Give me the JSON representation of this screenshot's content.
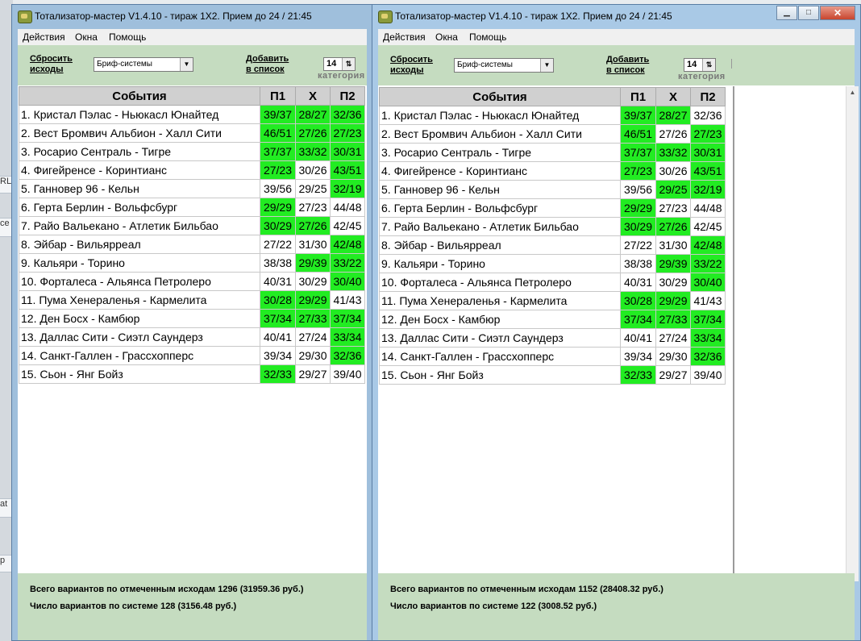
{
  "background": {
    "fragments": [
      "RL",
      "ce",
      "at",
      "p"
    ]
  },
  "colors": {
    "highlight": "#22ec22",
    "panel": "#c5dcc0"
  },
  "windows": [
    {
      "title": "Тотализатор-мастер V1.4.10 - тираж 1Х2. Прием до 24 / 21:45",
      "menu": [
        "Действия",
        "Окна",
        "Помощь"
      ],
      "toolbar": {
        "reset_line1": "Сбросить",
        "reset_line2": "исходы",
        "system": "Бриф-системы",
        "add_line1": "Добавить",
        "add_line2": "в список",
        "category_value": "14",
        "category_label": "категория"
      },
      "headers": [
        "События",
        "П1",
        "Х",
        "П2"
      ],
      "events": [
        {
          "name": "1. Кристал Пэлас - Ньюкасл Юнайтед",
          "odds": [
            "39/37",
            "28/27",
            "32/36"
          ],
          "on": [
            true,
            true,
            true
          ]
        },
        {
          "name": "2. Вест Бромвич Альбион - Халл Сити",
          "odds": [
            "46/51",
            "27/26",
            "27/23"
          ],
          "on": [
            true,
            true,
            true
          ]
        },
        {
          "name": "3. Росарио Сентраль - Тигре",
          "odds": [
            "37/37",
            "33/32",
            "30/31"
          ],
          "on": [
            true,
            true,
            true
          ]
        },
        {
          "name": "4. Фигейренсе - Коринтианс",
          "odds": [
            "27/23",
            "30/26",
            "43/51"
          ],
          "on": [
            true,
            false,
            true
          ]
        },
        {
          "name": "5. Ганновер 96 - Кельн",
          "odds": [
            "39/56",
            "29/25",
            "32/19"
          ],
          "on": [
            false,
            false,
            true
          ]
        },
        {
          "name": "6. Герта Берлин - Вольфсбург",
          "odds": [
            "29/29",
            "27/23",
            "44/48"
          ],
          "on": [
            true,
            false,
            false
          ]
        },
        {
          "name": "7. Райо Вальекано - Атлетик Бильбао",
          "odds": [
            "30/29",
            "27/26",
            "42/45"
          ],
          "on": [
            true,
            true,
            false
          ]
        },
        {
          "name": "8. Эйбар - Вильярреал",
          "odds": [
            "27/22",
            "31/30",
            "42/48"
          ],
          "on": [
            false,
            false,
            true
          ]
        },
        {
          "name": "9. Кальяри - Торино",
          "odds": [
            "38/38",
            "29/39",
            "33/22"
          ],
          "on": [
            false,
            true,
            true
          ]
        },
        {
          "name": "10. Форталеса - Альянса Петролеро",
          "odds": [
            "40/31",
            "30/29",
            "30/40"
          ],
          "on": [
            false,
            false,
            true
          ]
        },
        {
          "name": "11. Пума Хенераленья - Кармелита",
          "odds": [
            "30/28",
            "29/29",
            "41/43"
          ],
          "on": [
            true,
            true,
            false
          ]
        },
        {
          "name": "12. Ден Босх - Камбюр",
          "odds": [
            "37/34",
            "27/33",
            "37/34"
          ],
          "on": [
            true,
            true,
            true
          ]
        },
        {
          "name": "13. Даллас Сити - Сиэтл Саундерз",
          "odds": [
            "40/41",
            "27/24",
            "33/34"
          ],
          "on": [
            false,
            false,
            true
          ]
        },
        {
          "name": "14. Санкт-Галлен - Грассхопперс",
          "odds": [
            "39/34",
            "29/30",
            "32/36"
          ],
          "on": [
            false,
            false,
            true
          ]
        },
        {
          "name": "15. Сьон - Янг Бойз",
          "odds": [
            "32/33",
            "29/27",
            "39/40"
          ],
          "on": [
            true,
            false,
            false
          ]
        }
      ],
      "status": {
        "line1": "Всего вариантов по отмеченным исходам 1296 (31959.36 руб.)",
        "line2": "Число вариантов по системе 128 (3156.48 руб.)"
      }
    },
    {
      "title": "Тотализатор-мастер V1.4.10 - тираж 1Х2. Прием до 24 / 21:45",
      "menu": [
        "Действия",
        "Окна",
        "Помощь"
      ],
      "toolbar": {
        "reset_line1": "Сбросить",
        "reset_line2": "исходы",
        "system": "Бриф-системы",
        "add_line1": "Добавить",
        "add_line2": "в список",
        "category_value": "14",
        "category_label": "категория"
      },
      "headers": [
        "События",
        "П1",
        "Х",
        "П2"
      ],
      "events": [
        {
          "name": "1. Кристал Пэлас - Ньюкасл Юнайтед",
          "odds": [
            "39/37",
            "28/27",
            "32/36"
          ],
          "on": [
            true,
            true,
            false
          ]
        },
        {
          "name": "2. Вест Бромвич Альбион - Халл Сити",
          "odds": [
            "46/51",
            "27/26",
            "27/23"
          ],
          "on": [
            true,
            false,
            true
          ]
        },
        {
          "name": "3. Росарио Сентраль - Тигре",
          "odds": [
            "37/37",
            "33/32",
            "30/31"
          ],
          "on": [
            true,
            true,
            true
          ]
        },
        {
          "name": "4. Фигейренсе - Коринтианс",
          "odds": [
            "27/23",
            "30/26",
            "43/51"
          ],
          "on": [
            true,
            false,
            true
          ]
        },
        {
          "name": "5. Ганновер 96 - Кельн",
          "odds": [
            "39/56",
            "29/25",
            "32/19"
          ],
          "on": [
            false,
            true,
            true
          ]
        },
        {
          "name": "6. Герта Берлин - Вольфсбург",
          "odds": [
            "29/29",
            "27/23",
            "44/48"
          ],
          "on": [
            true,
            false,
            false
          ]
        },
        {
          "name": "7. Райо Вальекано - Атлетик Бильбао",
          "odds": [
            "30/29",
            "27/26",
            "42/45"
          ],
          "on": [
            true,
            true,
            false
          ]
        },
        {
          "name": "8. Эйбар - Вильярреал",
          "odds": [
            "27/22",
            "31/30",
            "42/48"
          ],
          "on": [
            false,
            false,
            true
          ]
        },
        {
          "name": "9. Кальяри - Торино",
          "odds": [
            "38/38",
            "29/39",
            "33/22"
          ],
          "on": [
            false,
            true,
            true
          ]
        },
        {
          "name": "10. Форталеса - Альянса Петролеро",
          "odds": [
            "40/31",
            "30/29",
            "30/40"
          ],
          "on": [
            false,
            false,
            true
          ]
        },
        {
          "name": "11. Пума Хенераленья - Кармелита",
          "odds": [
            "30/28",
            "29/29",
            "41/43"
          ],
          "on": [
            true,
            true,
            false
          ]
        },
        {
          "name": "12. Ден Босх - Камбюр",
          "odds": [
            "37/34",
            "27/33",
            "37/34"
          ],
          "on": [
            true,
            true,
            true
          ]
        },
        {
          "name": "13. Даллас Сити - Сиэтл Саундерз",
          "odds": [
            "40/41",
            "27/24",
            "33/34"
          ],
          "on": [
            false,
            false,
            true
          ]
        },
        {
          "name": "14. Санкт-Галлен - Грассхопперс",
          "odds": [
            "39/34",
            "29/30",
            "32/36"
          ],
          "on": [
            false,
            false,
            true
          ]
        },
        {
          "name": "15. Сьон - Янг Бойз",
          "odds": [
            "32/33",
            "29/27",
            "39/40"
          ],
          "on": [
            true,
            false,
            false
          ]
        }
      ],
      "status": {
        "line1": "Всего вариантов по отмеченным исходам 1152 (28408.32 руб.)",
        "line2": "Число вариантов по системе 122 (3008.52 руб.)"
      }
    }
  ]
}
